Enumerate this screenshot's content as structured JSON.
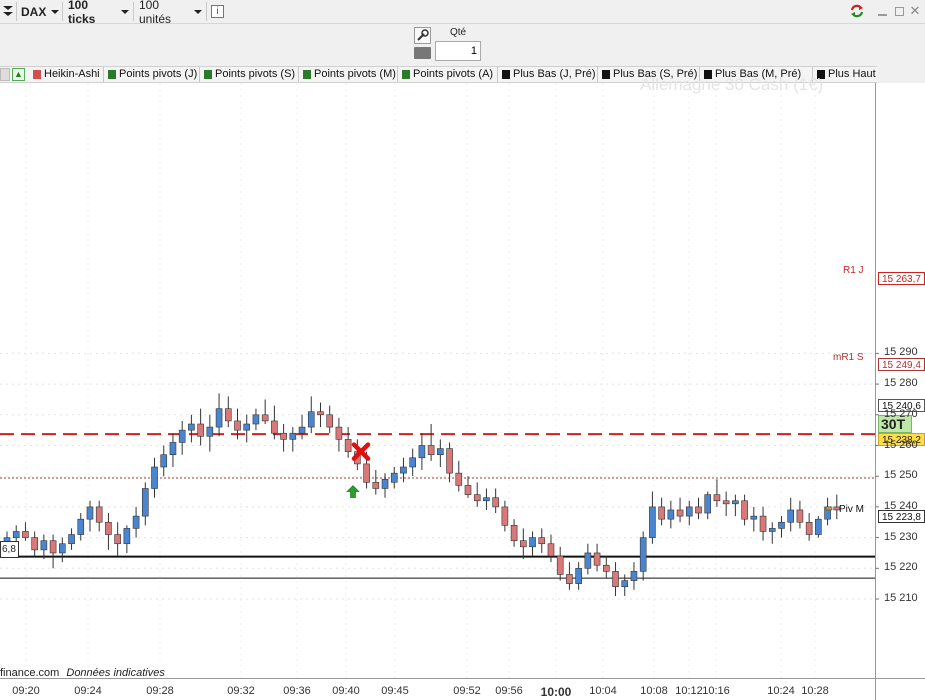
{
  "toolbar": {
    "instrument": "DAX",
    "period": "100 ticks",
    "units": "100 unités",
    "info_icon": "info-icon",
    "icons": {
      "refresh": "refresh-sync-icon",
      "minimize": "minimize-icon",
      "maximize": "maximize-icon",
      "close": "close-icon"
    }
  },
  "order": {
    "qty_label": "Qté",
    "qty_value": "1",
    "icons": {
      "order_tool": "wrench-icon",
      "keypad": "keyboard-icon"
    }
  },
  "indicator_tabs": [
    {
      "label": "Heikin-Ashi",
      "color": "#d05050"
    },
    {
      "label": "Points pivots (J)",
      "color": "#2a7a2a"
    },
    {
      "label": "Points pivots (S)",
      "color": "#2a7a2a"
    },
    {
      "label": "Points pivots (M)",
      "color": "#2a7a2a"
    },
    {
      "label": "Points pivots (A)",
      "color": "#2a7a2a"
    },
    {
      "label": "Plus Bas (J, Pré)",
      "color": "#111111"
    },
    {
      "label": "Plus Bas (S, Pré)",
      "color": "#111111"
    },
    {
      "label": "Plus Bas (M, Pré)",
      "color": "#111111"
    },
    {
      "label": "Plus Haut (J",
      "color": "#111111"
    }
  ],
  "chart": {
    "watermark": "Allemagne 30 Cash (1€)",
    "left_value": "6,8",
    "footer_source": "finance.com",
    "footer_note": "Données indicatives",
    "colors": {
      "up": "#4a86d0",
      "down": "#d87878",
      "r1": "#cc2222",
      "mr1": "#aa3333",
      "piv": "#111111",
      "current": "#ffdd44",
      "timer": "#bfe8a8"
    },
    "y_ticks": [
      "15 290",
      "15 280",
      "15 270",
      "15 260",
      "15 250",
      "15 240",
      "15 230",
      "15 220",
      "15 210"
    ],
    "x_ticks": [
      "09:20",
      "09:24",
      "09:28",
      "09:32",
      "09:36",
      "09:40",
      "09:45",
      "09:52",
      "09:56",
      "10:00",
      "10:04",
      "10:08",
      "10:12",
      "10:16",
      "10:24",
      "10:28"
    ],
    "lines": {
      "r1_label": "R1 J",
      "r1_value": "15 263,7",
      "mr1_label": "mR1 S",
      "mr1_value": "15 249,4",
      "piv_label": "Piv M",
      "piv_value": "15 223,8"
    },
    "price_tags": {
      "upper": "15 240,6",
      "current": "15 238,2",
      "timer": "30T"
    },
    "markers": {
      "sell": "red-x-marker-icon",
      "buy": "green-up-arrow-icon"
    }
  },
  "chart_data": {
    "type": "candlestick",
    "yrange": [
      15206,
      15297
    ],
    "y_ticks": [
      15290,
      15280,
      15270,
      15260,
      15250,
      15240,
      15230,
      15220,
      15210
    ],
    "x_ticks": [
      "09:20",
      "09:24",
      "09:28",
      "09:32",
      "09:36",
      "09:40",
      "09:45",
      "09:52",
      "09:56",
      "10:00",
      "10:04",
      "10:08",
      "10:12",
      "10:16",
      "10:24",
      "10:28"
    ],
    "horizontal_lines": [
      {
        "name": "R1 J",
        "value": 15263.7,
        "style": "dashed"
      },
      {
        "name": "mR1 S",
        "value": 15249.4,
        "style": "dotted"
      },
      {
        "name": "Piv M",
        "value": 15223.8,
        "style": "solid"
      },
      {
        "name": "",
        "value": 15216.8,
        "style": "solid"
      }
    ],
    "candles": [
      {
        "o": 15227,
        "h": 15232,
        "l": 15225,
        "c": 15230
      },
      {
        "o": 15230,
        "h": 15234,
        "l": 15226,
        "c": 15232
      },
      {
        "o": 15232,
        "h": 15235,
        "l": 15229,
        "c": 15230
      },
      {
        "o": 15230,
        "h": 15232,
        "l": 15224,
        "c": 15226
      },
      {
        "o": 15226,
        "h": 15231,
        "l": 15223,
        "c": 15229
      },
      {
        "o": 15229,
        "h": 15231,
        "l": 15220,
        "c": 15225
      },
      {
        "o": 15225,
        "h": 15230,
        "l": 15222,
        "c": 15228
      },
      {
        "o": 15228,
        "h": 15233,
        "l": 15226,
        "c": 15231
      },
      {
        "o": 15231,
        "h": 15238,
        "l": 15229,
        "c": 15236
      },
      {
        "o": 15236,
        "h": 15242,
        "l": 15232,
        "c": 15240
      },
      {
        "o": 15240,
        "h": 15242,
        "l": 15232,
        "c": 15235
      },
      {
        "o": 15235,
        "h": 15238,
        "l": 15226,
        "c": 15231
      },
      {
        "o": 15231,
        "h": 15235,
        "l": 15224,
        "c": 15228
      },
      {
        "o": 15228,
        "h": 15234,
        "l": 15225,
        "c": 15233
      },
      {
        "o": 15233,
        "h": 15240,
        "l": 15230,
        "c": 15237
      },
      {
        "o": 15237,
        "h": 15248,
        "l": 15234,
        "c": 15246
      },
      {
        "o": 15246,
        "h": 15256,
        "l": 15243,
        "c": 15253
      },
      {
        "o": 15253,
        "h": 15260,
        "l": 15250,
        "c": 15257
      },
      {
        "o": 15257,
        "h": 15264,
        "l": 15253,
        "c": 15261
      },
      {
        "o": 15261,
        "h": 15268,
        "l": 15257,
        "c": 15265
      },
      {
        "o": 15265,
        "h": 15270,
        "l": 15261,
        "c": 15267
      },
      {
        "o": 15267,
        "h": 15272,
        "l": 15260,
        "c": 15263
      },
      {
        "o": 15263,
        "h": 15270,
        "l": 15258,
        "c": 15266
      },
      {
        "o": 15266,
        "h": 15277,
        "l": 15263,
        "c": 15272
      },
      {
        "o": 15272,
        "h": 15276,
        "l": 15266,
        "c": 15268
      },
      {
        "o": 15268,
        "h": 15272,
        "l": 15262,
        "c": 15265
      },
      {
        "o": 15265,
        "h": 15270,
        "l": 15261,
        "c": 15267
      },
      {
        "o": 15267,
        "h": 15272,
        "l": 15265,
        "c": 15270
      },
      {
        "o": 15270,
        "h": 15275,
        "l": 15267,
        "c": 15268
      },
      {
        "o": 15268,
        "h": 15273,
        "l": 15262,
        "c": 15264
      },
      {
        "o": 15264,
        "h": 15267,
        "l": 15258,
        "c": 15262
      },
      {
        "o": 15262,
        "h": 15266,
        "l": 15258,
        "c": 15264
      },
      {
        "o": 15264,
        "h": 15270,
        "l": 15262,
        "c": 15266
      },
      {
        "o": 15266,
        "h": 15276,
        "l": 15264,
        "c": 15271
      },
      {
        "o": 15271,
        "h": 15274,
        "l": 15266,
        "c": 15270
      },
      {
        "o": 15270,
        "h": 15273,
        "l": 15264,
        "c": 15266
      },
      {
        "o": 15266,
        "h": 15269,
        "l": 15258,
        "c": 15262
      },
      {
        "o": 15262,
        "h": 15266,
        "l": 15256,
        "c": 15258
      },
      {
        "o": 15258,
        "h": 15262,
        "l": 15252,
        "c": 15254
      },
      {
        "o": 15254,
        "h": 15258,
        "l": 15246,
        "c": 15248
      },
      {
        "o": 15248,
        "h": 15252,
        "l": 15244,
        "c": 15246
      },
      {
        "o": 15246,
        "h": 15251,
        "l": 15243,
        "c": 15249
      },
      {
        "o": 15248,
        "h": 15253,
        "l": 15246,
        "c": 15251
      },
      {
        "o": 15251,
        "h": 15256,
        "l": 15248,
        "c": 15253
      },
      {
        "o": 15253,
        "h": 15259,
        "l": 15250,
        "c": 15256
      },
      {
        "o": 15256,
        "h": 15264,
        "l": 15252,
        "c": 15260
      },
      {
        "o": 15260,
        "h": 15267,
        "l": 15255,
        "c": 15257
      },
      {
        "o": 15257,
        "h": 15262,
        "l": 15253,
        "c": 15259
      },
      {
        "o": 15259,
        "h": 15261,
        "l": 15248,
        "c": 15251
      },
      {
        "o": 15251,
        "h": 15255,
        "l": 15245,
        "c": 15247
      },
      {
        "o": 15247,
        "h": 15250,
        "l": 15243,
        "c": 15244
      },
      {
        "o": 15244,
        "h": 15248,
        "l": 15240,
        "c": 15242
      },
      {
        "o": 15242,
        "h": 15246,
        "l": 15239,
        "c": 15243
      },
      {
        "o": 15243,
        "h": 15246,
        "l": 15238,
        "c": 15240
      },
      {
        "o": 15240,
        "h": 15242,
        "l": 15232,
        "c": 15234
      },
      {
        "o": 15234,
        "h": 15236,
        "l": 15227,
        "c": 15229
      },
      {
        "o": 15229,
        "h": 15233,
        "l": 15223,
        "c": 15227
      },
      {
        "o": 15227,
        "h": 15232,
        "l": 15224,
        "c": 15230
      },
      {
        "o": 15230,
        "h": 15233,
        "l": 15225,
        "c": 15228
      },
      {
        "o": 15228,
        "h": 15231,
        "l": 15222,
        "c": 15224
      },
      {
        "o": 15224,
        "h": 15227,
        "l": 15216,
        "c": 15218
      },
      {
        "o": 15218,
        "h": 15222,
        "l": 15213,
        "c": 15215
      },
      {
        "o": 15215,
        "h": 15222,
        "l": 15213,
        "c": 15220
      },
      {
        "o": 15220,
        "h": 15228,
        "l": 15218,
        "c": 15225
      },
      {
        "o": 15225,
        "h": 15228,
        "l": 15219,
        "c": 15221
      },
      {
        "o": 15221,
        "h": 15224,
        "l": 15217,
        "c": 15219
      },
      {
        "o": 15219,
        "h": 15222,
        "l": 15211,
        "c": 15214
      },
      {
        "o": 15214,
        "h": 15218,
        "l": 15211,
        "c": 15216
      },
      {
        "o": 15216,
        "h": 15222,
        "l": 15213,
        "c": 15219
      },
      {
        "o": 15219,
        "h": 15232,
        "l": 15216,
        "c": 15230
      },
      {
        "o": 15230,
        "h": 15245,
        "l": 15228,
        "c": 15240
      },
      {
        "o": 15240,
        "h": 15243,
        "l": 15234,
        "c": 15236
      },
      {
        "o": 15236,
        "h": 15242,
        "l": 15233,
        "c": 15239
      },
      {
        "o": 15239,
        "h": 15243,
        "l": 15235,
        "c": 15237
      },
      {
        "o": 15237,
        "h": 15242,
        "l": 15234,
        "c": 15240
      },
      {
        "o": 15240,
        "h": 15243,
        "l": 15236,
        "c": 15238
      },
      {
        "o": 15238,
        "h": 15245,
        "l": 15236,
        "c": 15244
      },
      {
        "o": 15244,
        "h": 15249,
        "l": 15240,
        "c": 15242
      },
      {
        "o": 15242,
        "h": 15245,
        "l": 15237,
        "c": 15241
      },
      {
        "o": 15241,
        "h": 15244,
        "l": 15237,
        "c": 15242
      },
      {
        "o": 15242,
        "h": 15244,
        "l": 15234,
        "c": 15236
      },
      {
        "o": 15236,
        "h": 15240,
        "l": 15232,
        "c": 15237
      },
      {
        "o": 15237,
        "h": 15240,
        "l": 15229,
        "c": 15232
      },
      {
        "o": 15232,
        "h": 15235,
        "l": 15228,
        "c": 15233
      },
      {
        "o": 15233,
        "h": 15237,
        "l": 15230,
        "c": 15235
      },
      {
        "o": 15235,
        "h": 15243,
        "l": 15232,
        "c": 15239
      },
      {
        "o": 15239,
        "h": 15242,
        "l": 15233,
        "c": 15235
      },
      {
        "o": 15235,
        "h": 15238,
        "l": 15229,
        "c": 15231
      },
      {
        "o": 15231,
        "h": 15237,
        "l": 15230,
        "c": 15236
      },
      {
        "o": 15236,
        "h": 15243,
        "l": 15234,
        "c": 15240
      },
      {
        "o": 15240,
        "h": 15244,
        "l": 15236,
        "c": 15239
      }
    ]
  }
}
